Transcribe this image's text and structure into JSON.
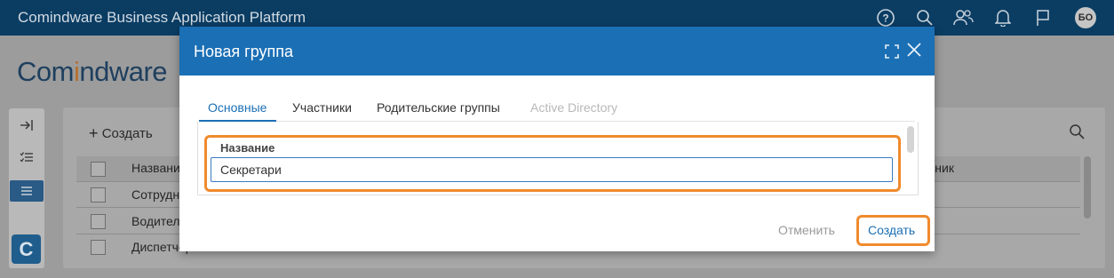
{
  "app": {
    "title": "Comindware Business Application Platform",
    "avatar_initials": "БО",
    "logo_prefix": "Com",
    "logo_highlight": "i",
    "logo_suffix": "ndware"
  },
  "toolbar_icons": [
    "help-icon",
    "search-icon",
    "users-icon",
    "bell-icon",
    "flag-icon"
  ],
  "background_page": {
    "create_label": "Создать",
    "column_name_header": "Названи",
    "column_right_header": "чник",
    "rows": [
      "Сотрудн",
      "Водител",
      "Диспетчера"
    ],
    "badge_letter": "C"
  },
  "modal": {
    "title": "Новая группа",
    "tabs": [
      {
        "label": "Основные",
        "state": "active"
      },
      {
        "label": "Участники",
        "state": "normal"
      },
      {
        "label": "Родительские группы",
        "state": "normal"
      },
      {
        "label": "Active Directory",
        "state": "disabled"
      }
    ],
    "field": {
      "label": "Название",
      "value": "Секретари"
    },
    "cancel_label": "Отменить",
    "create_label": "Создать"
  },
  "colors": {
    "header_bar": "#0b3d63",
    "modal_header": "#1b6fb5",
    "highlight": "#f08a2c"
  }
}
